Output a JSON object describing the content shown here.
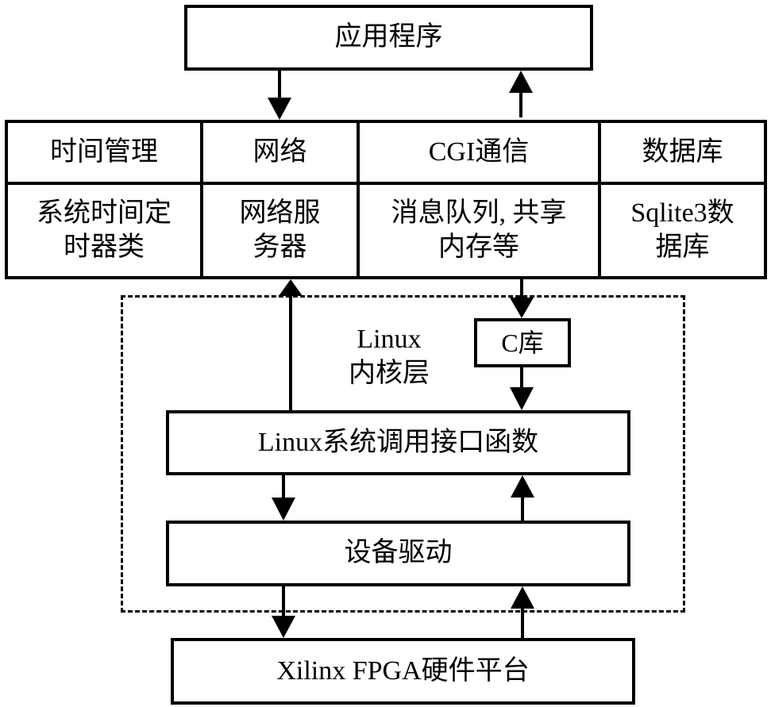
{
  "app": {
    "label": "应用程序"
  },
  "middleware": {
    "columns": [
      {
        "header": "时间管理",
        "detail_lines": [
          "系统时间定",
          "时器类"
        ]
      },
      {
        "header": "网络",
        "detail_lines": [
          "网络服",
          "务器"
        ]
      },
      {
        "header": "CGI通信",
        "detail_lines": [
          "消息队列, 共享",
          "内存等"
        ]
      },
      {
        "header": "数据库",
        "detail_lines": [
          "Sqlite3数",
          "据库"
        ]
      }
    ]
  },
  "kernel": {
    "title_lines": [
      "Linux",
      "内核层"
    ],
    "c_lib": "C库",
    "syscall": "Linux系统调用接口函数",
    "driver": "设备驱动"
  },
  "hardware": {
    "label": "Xilinx FPGA硬件平台"
  },
  "connections": [
    {
      "from": "应用程序",
      "to": "网络",
      "direction": "down"
    },
    {
      "from": "CGI通信",
      "to": "应用程序",
      "direction": "up"
    },
    {
      "from": "Linux系统调用接口函数",
      "to": "网络服务器",
      "direction": "up"
    },
    {
      "from": "消息队列, 共享内存等",
      "to": "C库",
      "direction": "down"
    },
    {
      "from": "C库",
      "to": "Linux系统调用接口函数",
      "direction": "down"
    },
    {
      "from": "Linux系统调用接口函数",
      "to": "设备驱动",
      "direction": "down"
    },
    {
      "from": "设备驱动",
      "to": "Linux系统调用接口函数",
      "direction": "up"
    },
    {
      "from": "设备驱动",
      "to": "Xilinx FPGA硬件平台",
      "direction": "down"
    },
    {
      "from": "Xilinx FPGA硬件平台",
      "to": "设备驱动",
      "direction": "up"
    }
  ]
}
